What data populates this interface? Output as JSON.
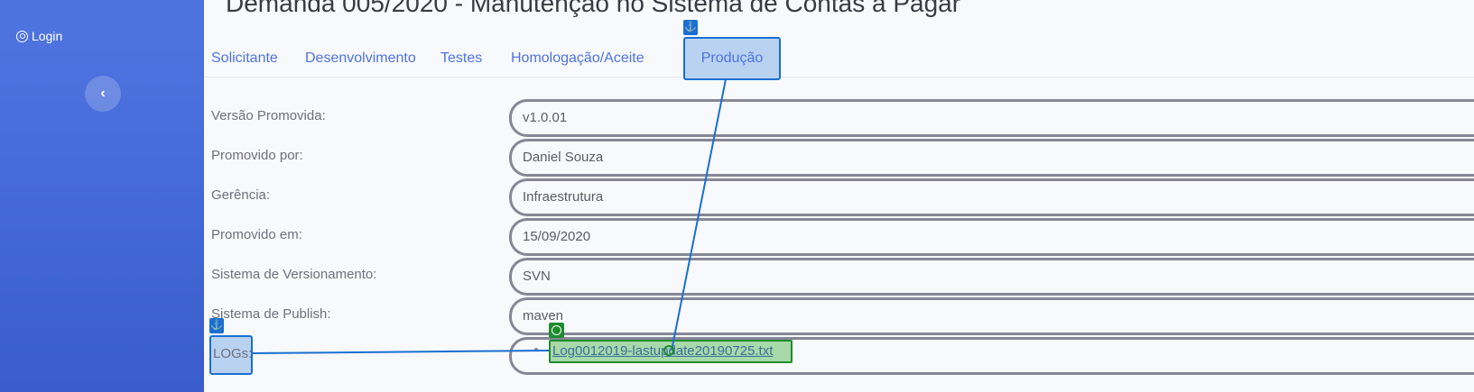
{
  "sidebar": {
    "login_label": "Login",
    "toggle_icon": "chevron-left-icon"
  },
  "page_title": "Demanda 005/2020 - Manutenção no Sistema de Contas a Pagar",
  "tabs": [
    {
      "label": "Solicitante"
    },
    {
      "label": "Desenvolvimento"
    },
    {
      "label": "Testes"
    },
    {
      "label": "Homologação/Aceite"
    },
    {
      "label": "Produção",
      "active": true
    }
  ],
  "form": {
    "fields": [
      {
        "label": "Versão Promovida:",
        "value": "v1.0.01"
      },
      {
        "label": "Promovido por:",
        "value": "Daniel Souza"
      },
      {
        "label": "Gerência:",
        "value": "Infraestrutura"
      },
      {
        "label": "Promovido em:",
        "value": "15/09/2020"
      },
      {
        "label": "Sistema de Versionamento:",
        "value": "SVN"
      },
      {
        "label": "Sistema de Publish:",
        "value": "maven"
      }
    ],
    "logs_label": "LOGs:",
    "log_link": "Log0012019-lastupdate20190725.txt"
  },
  "colors": {
    "sidebar": "#4e73df",
    "accent": "#4e73df",
    "highlight": "#1a6fd1",
    "link_highlight": "#1e8c2e"
  }
}
